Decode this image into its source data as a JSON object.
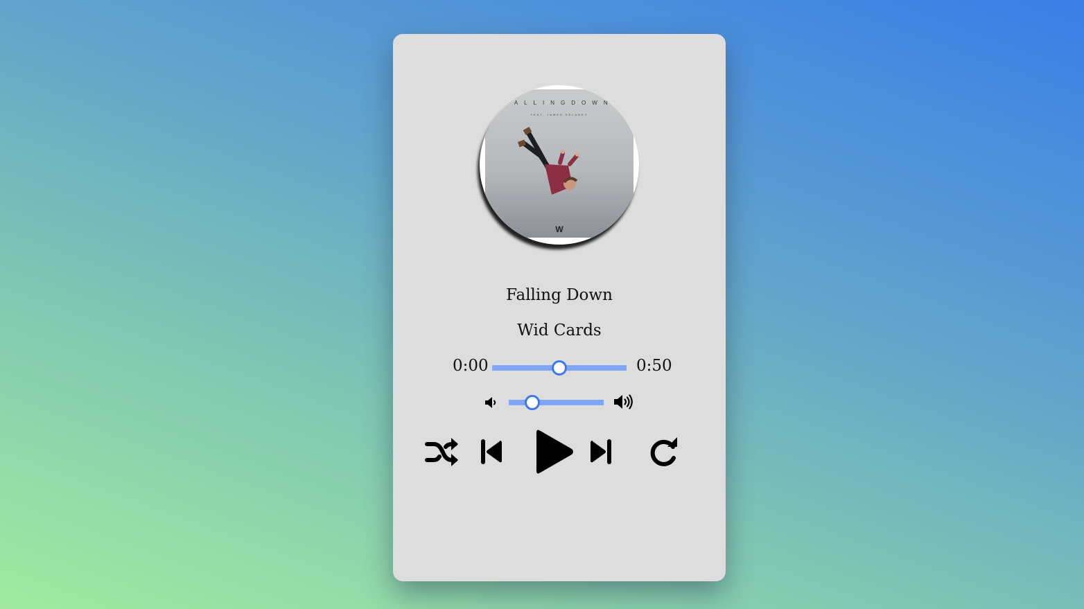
{
  "track": {
    "title": "Falling Down",
    "artist": "Wid Cards",
    "album_art_text": "FALLINGDOWN",
    "album_art_subtext": "FEAT. JAMES DELANEY",
    "album_logo": "W"
  },
  "playback": {
    "current_time": "0:00",
    "duration": "0:50",
    "seek_progress": 0.5,
    "volume_level": 0.25
  },
  "icons": {
    "volume_low": "volume-low-icon",
    "volume_high": "volume-high-icon",
    "shuffle": "shuffle-icon",
    "previous": "skip-previous-icon",
    "play": "play-icon",
    "next": "skip-next-icon",
    "repeat": "repeat-icon"
  },
  "colors": {
    "accent": "#3b78f0",
    "slider_track": "#7ea6f5",
    "card_bg": "#dddddd"
  }
}
